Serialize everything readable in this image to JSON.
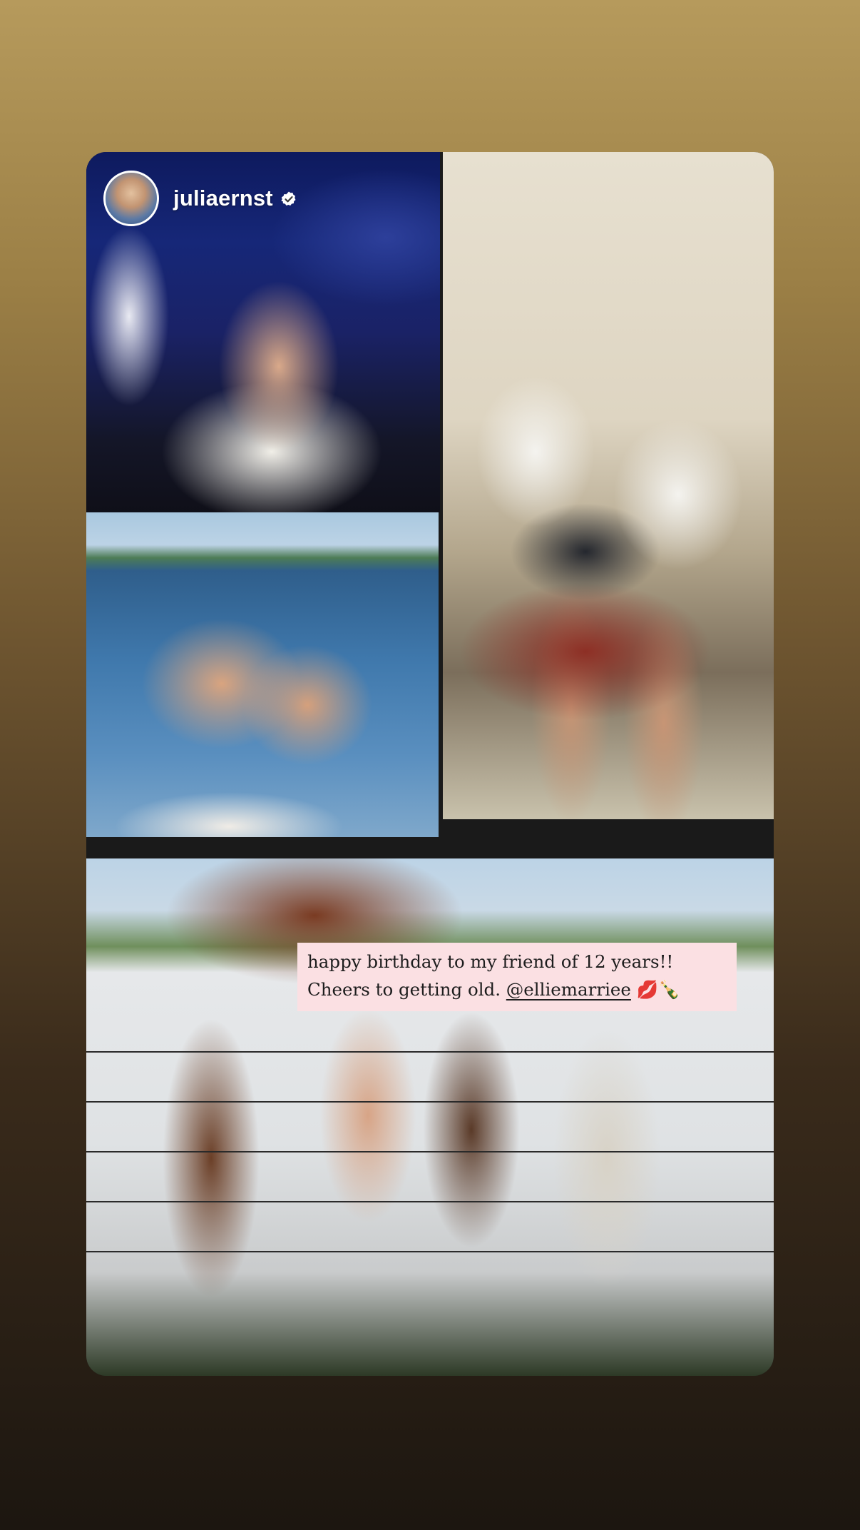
{
  "story": {
    "author": {
      "username": "juliaernst",
      "verified": true,
      "avatar_icon": "profile-avatar"
    },
    "caption": {
      "line1": "happy birthday to my friend of 12 years!!",
      "line2_prefix": "Cheers to getting old.",
      "mention": "@elliemarriee",
      "emojis": "💋🍾"
    },
    "photos": [
      {
        "name": "concert-night-photo"
      },
      {
        "name": "childhood-photo"
      },
      {
        "name": "lake-boat-photo"
      },
      {
        "name": "festival-group-photo"
      }
    ]
  },
  "colors": {
    "background_top": "#b69a5c",
    "background_bottom": "#1c1610",
    "caption_bg": "#fbe0e3",
    "username": "#ffffff"
  }
}
